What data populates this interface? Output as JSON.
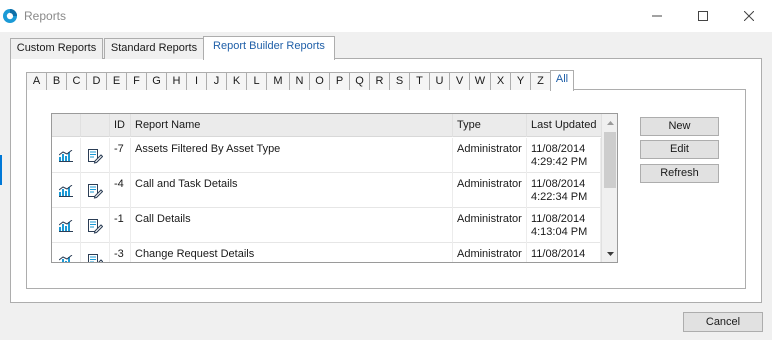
{
  "window": {
    "title": "Reports"
  },
  "outer_tabs": [
    {
      "label": "Custom Reports"
    },
    {
      "label": "Standard Reports"
    },
    {
      "label": "Report Builder Reports",
      "active": true
    }
  ],
  "letter_tabs": [
    "A",
    "B",
    "C",
    "D",
    "E",
    "F",
    "G",
    "H",
    "I",
    "J",
    "K",
    "L",
    "M",
    "N",
    "O",
    "P",
    "Q",
    "R",
    "S",
    "T",
    "U",
    "V",
    "W",
    "X",
    "Y",
    "Z",
    "All"
  ],
  "active_letter": "All",
  "grid": {
    "columns": [
      "",
      "",
      "ID",
      "Report Name",
      "Type",
      "Last Updated"
    ],
    "rows": [
      {
        "id": "-7",
        "name": "Assets Filtered By Asset Type",
        "type": "Administrator",
        "updated_date": "11/08/2014",
        "updated_time": "4:29:42 PM"
      },
      {
        "id": "-4",
        "name": "Call and Task Details",
        "type": "Administrator",
        "updated_date": "11/08/2014",
        "updated_time": "4:22:34 PM"
      },
      {
        "id": "-1",
        "name": "Call Details",
        "type": "Administrator",
        "updated_date": "11/08/2014",
        "updated_time": "4:13:04 PM"
      },
      {
        "id": "-3",
        "name": "Change Request Details",
        "type": "Administrator",
        "updated_date": "11/08/2014",
        "updated_time": ""
      }
    ]
  },
  "buttons": {
    "new": "New",
    "edit": "Edit",
    "refresh": "Refresh",
    "cancel": "Cancel"
  },
  "colors": {
    "accent": "#1f5fa8",
    "icon_teal": "#1b9ad6",
    "icon_dark": "#2b3d55"
  },
  "icons": {
    "app": "app-logo-icon",
    "row_chart": "bar-chart-icon",
    "row_edit": "edit-report-icon"
  }
}
